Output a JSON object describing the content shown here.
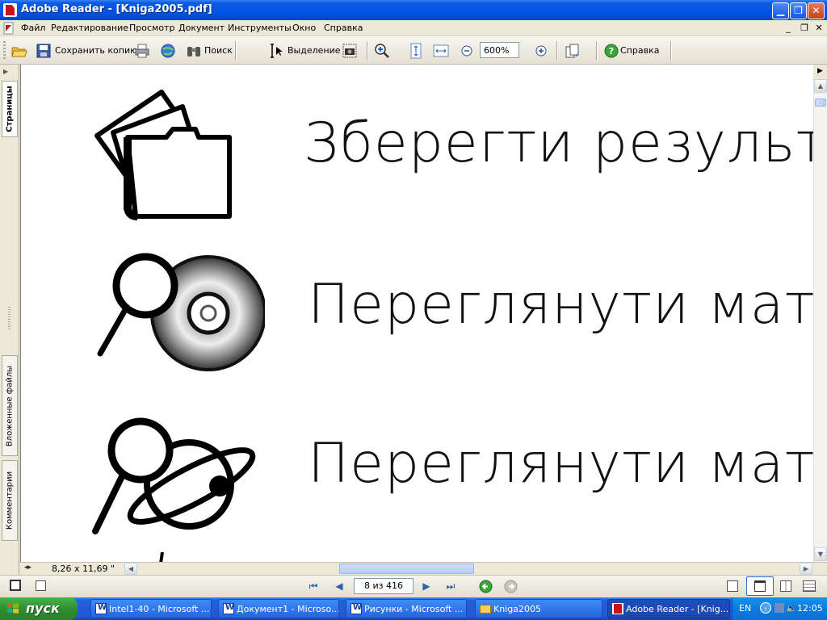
{
  "window": {
    "title": "Adobe Reader - [Kniga2005.pdf]"
  },
  "menu": {
    "items": [
      "Файл",
      "Редактирование",
      "Просмотр",
      "Документ",
      "Инструменты",
      "Окно",
      "Справка"
    ]
  },
  "toolbar": {
    "save_copy": "Сохранить копию",
    "search": "Поиск",
    "select": "Выделение",
    "zoom": "600%",
    "help": "Справка"
  },
  "left_tabs": {
    "pages": "Страницы",
    "attachments": "Вложенные файлы",
    "comments": "Комментарии"
  },
  "document": {
    "line1": "Зберегти результат",
    "line2": "Переглянути матер",
    "line3": "Переглянути матер"
  },
  "statusbar": {
    "page_size": "8,26 x 11,69 \"",
    "page_field": "8 из 416"
  },
  "taskbar": {
    "start": "пуск",
    "tasks": [
      {
        "label": "Intel1-40 - Microsoft ...",
        "icon": "word-icon"
      },
      {
        "label": "Документ1 - Microso...",
        "icon": "word-icon"
      },
      {
        "label": "Рисунки - Microsoft ...",
        "icon": "word-icon"
      },
      {
        "label": "Kniga2005",
        "icon": "folder-icon"
      },
      {
        "label": "Adobe Reader - [Knig...",
        "icon": "adobe-icon"
      }
    ],
    "lang": "EN",
    "clock": "12:05"
  }
}
